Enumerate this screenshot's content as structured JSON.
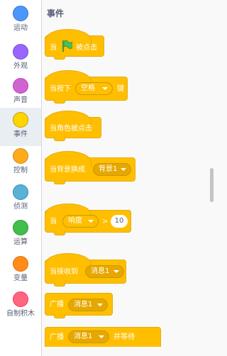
{
  "categories": [
    {
      "label": "运动",
      "color": "#4c97ff"
    },
    {
      "label": "外观",
      "color": "#9966ff"
    },
    {
      "label": "声音",
      "color": "#cf63cf"
    },
    {
      "label": "事件",
      "color": "#ffd500"
    },
    {
      "label": "控制",
      "color": "#ffab19"
    },
    {
      "label": "侦测",
      "color": "#5cb1d6"
    },
    {
      "label": "运算",
      "color": "#40bf4a"
    },
    {
      "label": "变量",
      "color": "#ff8c1a"
    },
    {
      "label": "自制积木",
      "color": "#ff6680"
    }
  ],
  "selected_category": "事件",
  "section_title": "事件",
  "blocks": {
    "flag_clicked": {
      "prefix": "当",
      "suffix": "被点击",
      "icon": "green-flag-icon"
    },
    "key_pressed": {
      "prefix": "当按下",
      "key": "空格",
      "suffix": "键"
    },
    "sprite_clicked": {
      "text": "当角色被点击"
    },
    "backdrop_switch": {
      "text": "当背景换成",
      "backdrop": "背景1"
    },
    "greater_than": {
      "prefix": "当",
      "sensor": "响度",
      "op": ">",
      "value": "10"
    },
    "receive": {
      "text": "当接收到",
      "message": "消息1"
    },
    "broadcast": {
      "text": "广播",
      "message": "消息1"
    },
    "broadcast_wait": {
      "text": "广播",
      "message": "消息1",
      "suffix": "并等待"
    }
  }
}
